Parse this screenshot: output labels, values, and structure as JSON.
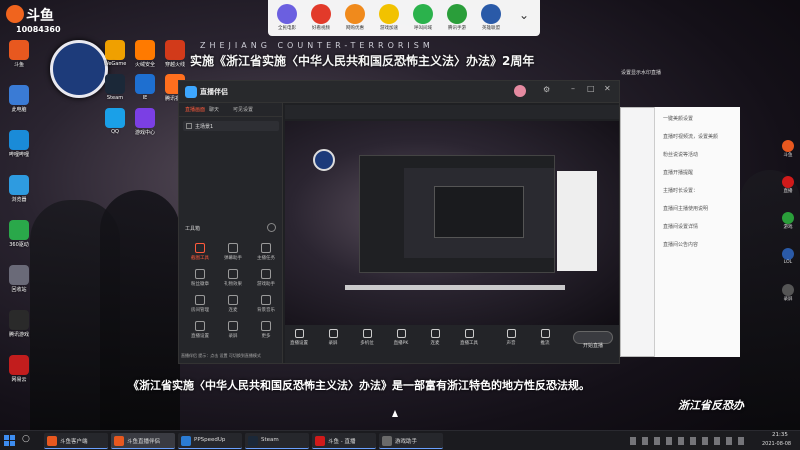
{
  "banner": {
    "en": "ZHEJIANG COUNTER-TERRORISM",
    "cn": "实施《浙江省实施〈中华人民共和国反恐怖主义法〉办法》2周年"
  },
  "logo_text": "斗鱼",
  "room_id": "10084360",
  "topbar": [
    {
      "label": "全民电影",
      "color": "#6b5fe0"
    },
    {
      "label": "好看视频",
      "color": "#e23a2a"
    },
    {
      "label": "网购优惠",
      "color": "#f08a1c"
    },
    {
      "label": "游戏加速",
      "color": "#f2c200"
    },
    {
      "label": "呼叫间域",
      "color": "#2bb24c"
    },
    {
      "label": "腾讯手游",
      "color": "#2a9e3a"
    },
    {
      "label": "英雄联盟",
      "color": "#2a5aa8"
    }
  ],
  "desktop_icons": [
    {
      "label": "斗鱼",
      "color": "#e8581f"
    },
    {
      "label": "此电脑",
      "color": "#3a7bd5"
    },
    {
      "label": "哔哩哔哩",
      "color": "#1a8bd8"
    },
    {
      "label": "浏览器",
      "color": "#2e9be0"
    },
    {
      "label": "360驱动",
      "color": "#2aa84a"
    },
    {
      "label": "回收站",
      "color": "#6a6a78"
    },
    {
      "label": "腾讯游戏",
      "color": "#2a2a2a"
    },
    {
      "label": "网易云",
      "color": "#c21d1d"
    },
    {
      "label": "WeGame",
      "color": "#f0a000"
    },
    {
      "label": "火绒安全",
      "color": "#ff7a00"
    },
    {
      "label": "穿越火线",
      "color": "#d23a1a"
    },
    {
      "label": "Steam",
      "color": "#1b2838"
    },
    {
      "label": "IE",
      "color": "#1e6fd0"
    },
    {
      "label": "腾讯视频",
      "color": "#ff6f1e"
    },
    {
      "label": "QQ",
      "color": "#1aa0e8"
    },
    {
      "label": "游戏中心",
      "color": "#7b3fe4"
    }
  ],
  "app": {
    "title": "直播伴侣",
    "tabs": [
      "直播画面",
      "聊天",
      "可见设置"
    ],
    "scene": "主场景1",
    "tools_title": "工具箱",
    "tools": [
      "截图工具",
      "弹幕助手",
      "主播任务",
      "粉丝徽章",
      "礼物效果",
      "游戏助手",
      "房间管理",
      "连麦",
      "背景音乐",
      "直播设置",
      "录屏",
      "更多"
    ],
    "footer_note": "直播伴侣 提示：点击 设置 可切换到直播模式",
    "controls": [
      "直播设置",
      "录屏",
      "多机位",
      "直播PK",
      "连麦",
      "直播工具",
      "声音",
      "推流"
    ],
    "start_label": "开始直播"
  },
  "panel": {
    "title": "设置显示水印直播",
    "lines": [
      "一键美颜设置",
      "直播时视频流，设置美颜",
      "粉丝说说等活动",
      "直播开播提醒",
      "主播时长设置：",
      "直播间主播使用说明",
      "直播间设置详情",
      "直播间公告内容"
    ]
  },
  "subtitle": "《浙江省实施〈中华人民共和国反恐怖主义法〉办法》是一部富有浙江特色的地方性反恐法规。",
  "corner_brand": "浙江省反恐办",
  "right_icons": [
    {
      "label": "斗鱼",
      "color": "#e8581f"
    },
    {
      "label": "直播",
      "color": "#d01a1a"
    },
    {
      "label": "游戏",
      "color": "#2a9e3a"
    },
    {
      "label": "LOL",
      "color": "#2a5aa8"
    },
    {
      "label": "录屏",
      "color": "#555"
    }
  ],
  "taskbar": {
    "apps": [
      {
        "label": "斗鱼客户端",
        "color": "#e8581f"
      },
      {
        "label": "斗鱼直播伴侣",
        "color": "#e8581f"
      },
      {
        "label": "PPSpeedUp",
        "color": "#2b7cd3"
      },
      {
        "label": "Steam",
        "color": "#1b2838"
      },
      {
        "label": "斗鱼 - 直播",
        "color": "#d01a1a"
      },
      {
        "label": "游戏助手",
        "color": "#6a6a6a"
      }
    ],
    "time": "21:35",
    "date": "2021-08-08"
  }
}
